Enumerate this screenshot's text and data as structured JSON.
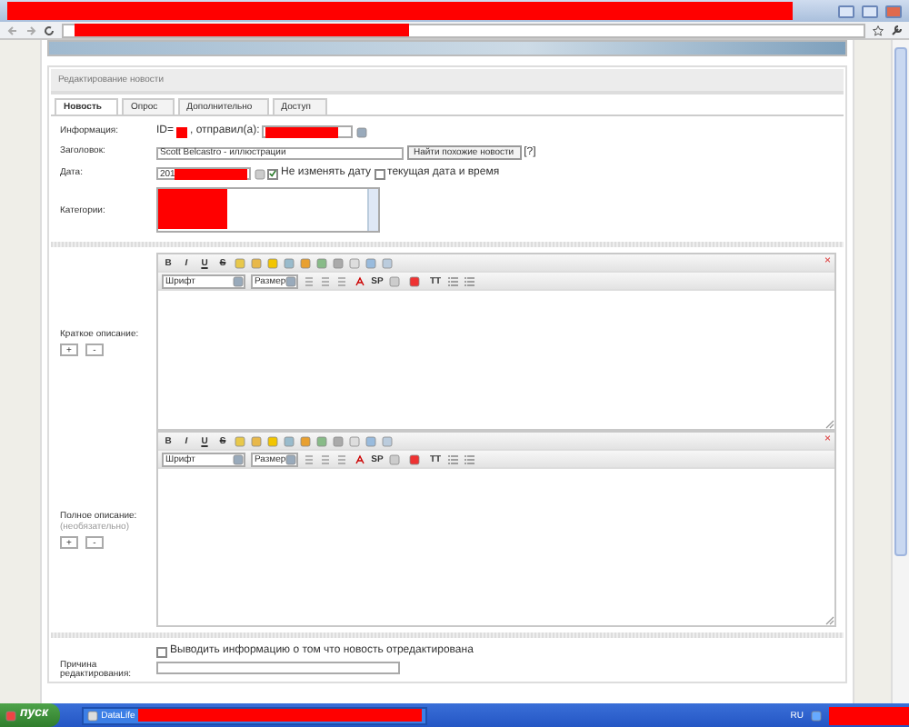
{
  "panel_title": "Редактирование новости",
  "tabs": [
    {
      "label": "Новость",
      "selected": true
    },
    {
      "label": "Опрос",
      "selected": false
    },
    {
      "label": "Дополнительно",
      "selected": false
    },
    {
      "label": "Доступ",
      "selected": false
    }
  ],
  "info": {
    "label": "Информация:",
    "id_prefix": "ID=",
    "sender_label": ", отправил(а):"
  },
  "title_field": {
    "label": "Заголовок:",
    "value": "Scott Belcastro - иллюстрации",
    "find_button": "Найти похожие новости",
    "help": "[?]"
  },
  "date_field": {
    "label": "Дата:",
    "value": "201",
    "keep_date": {
      "label": "Не изменять дату",
      "checked": true
    },
    "current_date": {
      "label": "текущая дата и время",
      "checked": false
    }
  },
  "categories": {
    "label": "Категории:"
  },
  "editors": [
    {
      "label": "Краткое описание:",
      "close_button": "×",
      "format_buttons": [
        "B",
        "I",
        "U",
        "S"
      ],
      "font_select": "Шрифт",
      "size_select": "Размер",
      "text_buttons": [
        "SP",
        "TT"
      ],
      "expand_buttons": [
        "+",
        "-"
      ]
    },
    {
      "label": "Полное описание:",
      "note": "(необязательно)",
      "close_button": "×",
      "format_buttons": [
        "B",
        "I",
        "U",
        "S"
      ],
      "font_select": "Шрифт",
      "size_select": "Размер",
      "text_buttons": [
        "SP",
        "TT"
      ],
      "expand_buttons": [
        "+",
        "-"
      ]
    }
  ],
  "edited_notice": {
    "label": "Выводить информацию о том что новость отредактирована",
    "checked": false
  },
  "reason": {
    "label": "Причина редактирования:"
  },
  "taskbar": {
    "start": "пуск",
    "task": "DataLife",
    "language": "RU"
  }
}
